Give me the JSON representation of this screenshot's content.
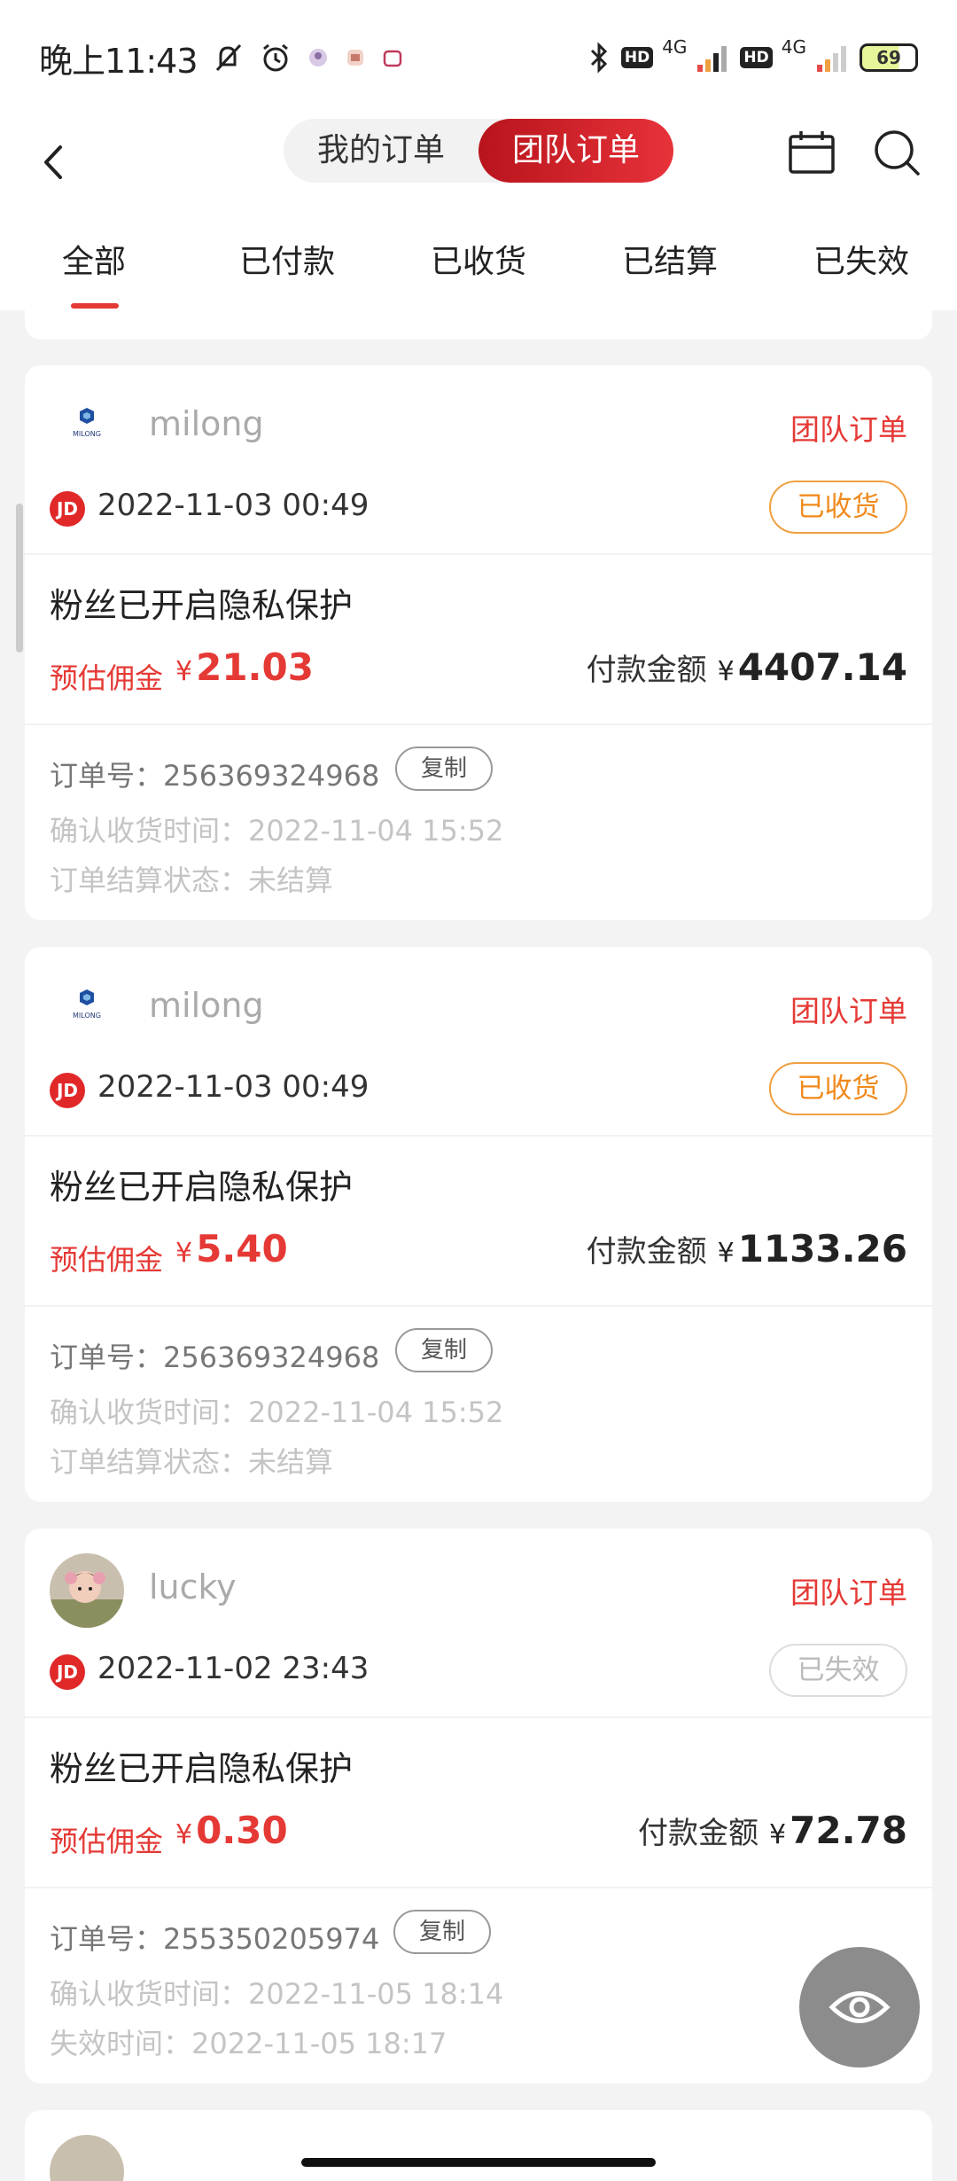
{
  "status_bar": {
    "time": "晚上11:43",
    "network_1": "4G",
    "network_2": "4G",
    "hd_1": "HD",
    "hd_2": "HD",
    "battery": "69"
  },
  "header": {
    "segment_mine": "我的订单",
    "segment_team": "团队订单",
    "active_segment": "团队订单"
  },
  "tabs": [
    "全部",
    "已付款",
    "已收货",
    "已结算",
    "已失效"
  ],
  "active_tab": "全部",
  "colors": {
    "accent": "#e53935",
    "received": "#f08a1c",
    "invalid": "#bbbbbb"
  },
  "orders": [
    {
      "user": "milong",
      "avatar": "milong-logo",
      "avatar_text": "MILONG",
      "tag": "团队订单",
      "platform": "JD",
      "datetime": "2022-11-03 00:49",
      "status": "已收货",
      "title": "粉丝已开启隐私保护",
      "commission_label": "预估佣金",
      "currency": "¥",
      "commission": "21.03",
      "pay_label": "付款金额",
      "pay_amount": "4407.14",
      "order_no_line": "订单号：256369324968",
      "copy": "复制",
      "meta1": "确认收货时间：2022-11-04 15:52",
      "meta2": "订单结算状态：未结算"
    },
    {
      "user": "milong",
      "avatar": "milong-logo",
      "avatar_text": "MILONG",
      "tag": "团队订单",
      "platform": "JD",
      "datetime": "2022-11-03 00:49",
      "status": "已收货",
      "title": "粉丝已开启隐私保护",
      "commission_label": "预估佣金",
      "currency": "¥",
      "commission": "5.40",
      "pay_label": "付款金额",
      "pay_amount": "1133.26",
      "order_no_line": "订单号：256369324968",
      "copy": "复制",
      "meta1": "确认收货时间：2022-11-04 15:52",
      "meta2": "订单结算状态：未结算"
    },
    {
      "user": "lucky",
      "avatar": "child-photo",
      "tag": "团队订单",
      "platform": "JD",
      "datetime": "2022-11-02 23:43",
      "status": "已失效",
      "title": "粉丝已开启隐私保护",
      "commission_label": "预估佣金",
      "currency": "¥",
      "commission": "0.30",
      "pay_label": "付款金额",
      "pay_amount": "72.78",
      "order_no_line": "订单号：255350205974",
      "copy": "复制",
      "meta1": "确认收货时间：2022-11-05 18:14",
      "meta2": "失效时间：2022-11-05 18:17"
    }
  ]
}
